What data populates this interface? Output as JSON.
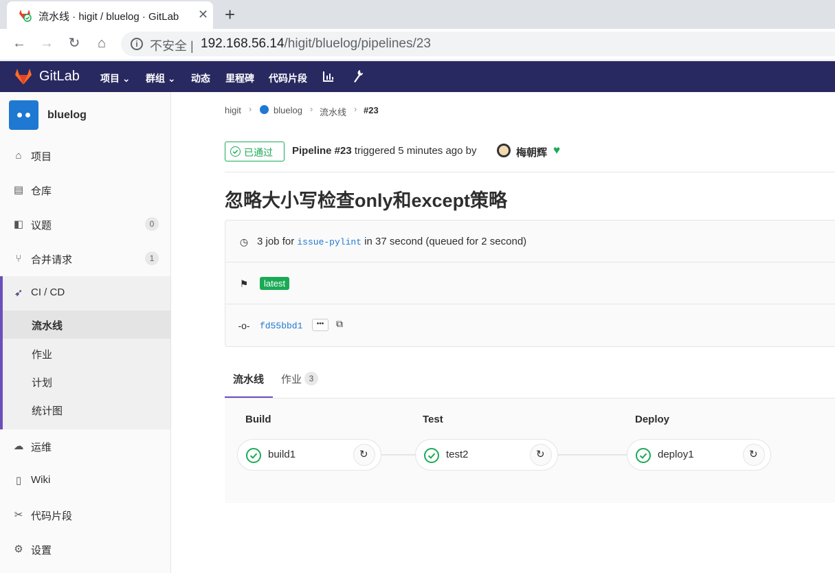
{
  "browser": {
    "tab_title": "流水线 · higit / bluelog · GitLab",
    "insecure_label": "不安全",
    "url_host": "192.168.56.14",
    "url_path": "/higit/bluelog/pipelines/23"
  },
  "topnav": {
    "brand": "GitLab",
    "items": [
      "项目",
      "群组",
      "动态",
      "里程碑",
      "代码片段"
    ]
  },
  "sidebar": {
    "project_name": "bluelog",
    "items": [
      {
        "label": "项目",
        "icon": "home-icon"
      },
      {
        "label": "仓库",
        "icon": "doc-icon"
      },
      {
        "label": "议题",
        "icon": "issues-icon",
        "count": "0"
      },
      {
        "label": "合并请求",
        "icon": "merge-request-icon",
        "count": "1"
      },
      {
        "label": "CI / CD",
        "icon": "rocket-icon"
      },
      {
        "label": "运维",
        "icon": "cloud-gear-icon"
      },
      {
        "label": "Wiki",
        "icon": "book-icon"
      },
      {
        "label": "代码片段",
        "icon": "scissors-icon"
      },
      {
        "label": "设置",
        "icon": "gear-icon"
      }
    ],
    "cicd_sub": [
      "流水线",
      "作业",
      "计划",
      "统计图"
    ]
  },
  "breadcrumb": [
    "higit",
    "bluelog",
    "流水线",
    "#23"
  ],
  "pipeline": {
    "status_label": "已通过",
    "pipeline_label": "Pipeline #23",
    "triggered_text": "triggered 5 minutes ago by",
    "user": "梅朝辉",
    "title": "忽略大小写检查only和except策略",
    "jobs_count_text": "3 job for",
    "branch": "issue-pylint",
    "duration_text": "in 37 second (queued for 2 second)",
    "tag": "latest",
    "commit": "fd55bbd1"
  },
  "tabs": {
    "pipeline": "流水线",
    "jobs": "作业",
    "jobs_count": "3"
  },
  "stages": [
    {
      "name": "Build",
      "job": "build1"
    },
    {
      "name": "Test",
      "job": "test2"
    },
    {
      "name": "Deploy",
      "job": "deploy1"
    }
  ],
  "colors": {
    "nav": "#292961",
    "success": "#1aaa55",
    "accent": "#6b4fbb",
    "link": "#1f78d1"
  }
}
